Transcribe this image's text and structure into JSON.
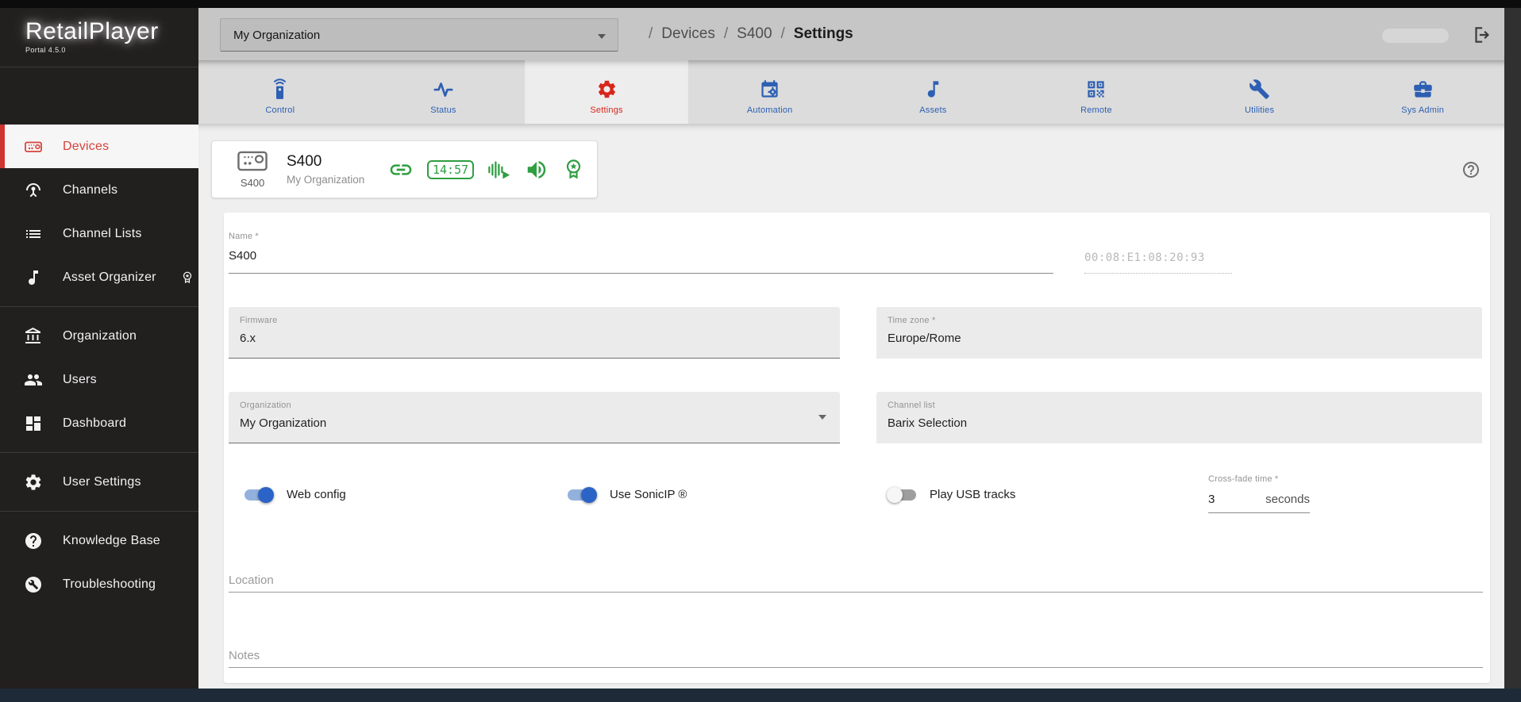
{
  "brand": {
    "name": "RetailPlayer",
    "version": "Portal 4.5.0"
  },
  "header": {
    "org_select_value": "My Organization",
    "separator": "/",
    "breadcrumb": [
      "Devices",
      "S400",
      "Settings"
    ]
  },
  "tabs": [
    {
      "label": "Control",
      "icon": "remote-control-icon",
      "active": false
    },
    {
      "label": "Status",
      "icon": "pulse-icon",
      "active": false
    },
    {
      "label": "Settings",
      "icon": "gear-icon",
      "active": true
    },
    {
      "label": "Automation",
      "icon": "calendar-gear-icon",
      "active": false
    },
    {
      "label": "Assets",
      "icon": "music-note-icon",
      "active": false
    },
    {
      "label": "Remote",
      "icon": "qr-code-icon",
      "active": false
    },
    {
      "label": "Utilities",
      "icon": "wrench-icon",
      "active": false
    },
    {
      "label": "Sys Admin",
      "icon": "toolbox-icon",
      "active": false
    }
  ],
  "sidebar": {
    "active_item": "Devices",
    "items": [
      {
        "label": "Devices",
        "icon": "device-icon",
        "active": true
      },
      {
        "label": "Channels",
        "icon": "antenna-icon",
        "active": false
      },
      {
        "label": "Channel Lists",
        "icon": "list-icon",
        "active": false
      },
      {
        "label": "Asset Organizer",
        "icon": "music-note-icon",
        "badge": "premium-badge-icon",
        "active": false
      },
      {
        "label": "Organization",
        "icon": "bank-icon",
        "active": false
      },
      {
        "label": "Users",
        "icon": "users-icon",
        "active": false
      },
      {
        "label": "Dashboard",
        "icon": "dashboard-icon",
        "active": false
      },
      {
        "label": "User Settings",
        "icon": "gear-icon",
        "active": false
      },
      {
        "label": "Knowledge Base",
        "icon": "help-circle-icon",
        "active": false
      },
      {
        "label": "Troubleshooting",
        "icon": "wrench-circle-icon",
        "active": false
      }
    ]
  },
  "device_card": {
    "device_type_label": "S400",
    "title": "S400",
    "subtitle": "My Organization",
    "clock": "14:57",
    "status_icons": [
      "link-icon",
      "clock-badge",
      "playing-icon",
      "volume-icon",
      "premium-badge-icon"
    ]
  },
  "form": {
    "name_label": "Name *",
    "name_value": "S400",
    "mac_value": "00:08:E1:08:20:93",
    "firmware_label": "Firmware",
    "firmware_value": "6.x",
    "timezone_label": "Time zone *",
    "timezone_value": "Europe/Rome",
    "organization_label": "Organization",
    "organization_value": "My Organization",
    "channel_list_label": "Channel list",
    "channel_list_value": "Barix Selection",
    "toggles": [
      {
        "label": "Web config",
        "on": true
      },
      {
        "label": "Use SonicIP ®",
        "on": true
      },
      {
        "label": "Play USB tracks",
        "on": false
      }
    ],
    "crossfade_label": "Cross-fade time *",
    "crossfade_value": "3",
    "crossfade_unit": "seconds",
    "location_label": "Location",
    "location_value": "",
    "notes_label": "Notes",
    "notes_value": ""
  },
  "colors": {
    "accent_red": "#d8261c",
    "sidebar_active_red": "#cf3430",
    "tab_blue": "#2d5fb3",
    "status_green": "#2f9e41",
    "toggle_on_thumb": "#2b63c6",
    "toggle_on_track": "#93b1dd",
    "bottom_bar": "#1e2a38"
  }
}
